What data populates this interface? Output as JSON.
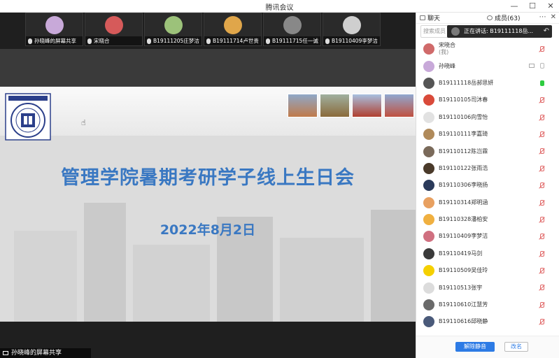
{
  "window": {
    "title": "腾讯会议"
  },
  "thumbnails": [
    {
      "name": "孙晓峰的屏幕共享",
      "color": "#c8a9d9"
    },
    {
      "name": "宋晓合",
      "color": "#d65a5a"
    },
    {
      "name": "B19111205庄梦洁",
      "color": "#9cc27a"
    },
    {
      "name": "B19111714卢世贵",
      "color": "#e0a64a"
    },
    {
      "name": "B19111715任一诚",
      "color": "#888888"
    },
    {
      "name": "B19110409李梦洁",
      "color": "#cfcfcf"
    }
  ],
  "slide": {
    "headline": "管理学院暑期考研学子线上生日会",
    "date": "2022年8月2日"
  },
  "share_label": "孙晓峰的屏幕共享",
  "panel": {
    "tab_chat": "聊天",
    "tab_members": "成员(63)",
    "search_placeholder": "搜索成员",
    "speaking_text": "正在讲话: B19111118岳...",
    "members": [
      {
        "name": "宋晓合",
        "sub": "(我)",
        "color": "#d06a6a",
        "mic": "muted"
      },
      {
        "name": "孙晓峰",
        "sub": "",
        "color": "#c8a9d9",
        "mic": "gray",
        "screen": true
      },
      {
        "name": "B19111118岳郝思妍",
        "sub": "",
        "color": "#555555",
        "mic": "on"
      },
      {
        "name": "B19110105司沐春",
        "sub": "",
        "color": "#d94a3a",
        "mic": "muted"
      },
      {
        "name": "B19110106向雪怡",
        "sub": "",
        "color": "#e2e2e2",
        "mic": "muted"
      },
      {
        "name": "B19110111李嘉琦",
        "sub": "",
        "color": "#b08a5a",
        "mic": "muted"
      },
      {
        "name": "B19110112陈岂霖",
        "sub": "",
        "color": "#7a6a5a",
        "mic": "muted"
      },
      {
        "name": "B19110122张雨浩",
        "sub": "",
        "color": "#4a3a2a",
        "mic": "muted"
      },
      {
        "name": "B19110306李晓扬",
        "sub": "",
        "color": "#2a3a5a",
        "mic": "muted"
      },
      {
        "name": "B19110314郑明涵",
        "sub": "",
        "color": "#e8a060",
        "mic": "muted"
      },
      {
        "name": "B19110328潘柏安",
        "sub": "",
        "color": "#f0b040",
        "mic": "muted"
      },
      {
        "name": "B19110409李梦洁",
        "sub": "",
        "color": "#d07080",
        "mic": "muted"
      },
      {
        "name": "B19110419马剑",
        "sub": "",
        "color": "#3a3a3a",
        "mic": "muted"
      },
      {
        "name": "B19110509吴佳玲",
        "sub": "",
        "color": "#f5d000",
        "mic": "muted"
      },
      {
        "name": "B19110513张宇",
        "sub": "",
        "color": "#dcdcdc",
        "mic": "muted"
      },
      {
        "name": "B19110610江慧芳",
        "sub": "",
        "color": "#6a6a6a",
        "mic": "muted"
      },
      {
        "name": "B19110616邱晓静",
        "sub": "",
        "color": "#4a5a7a",
        "mic": "muted"
      }
    ],
    "mute_all_label": "解除静音",
    "rename_label": "改名"
  }
}
